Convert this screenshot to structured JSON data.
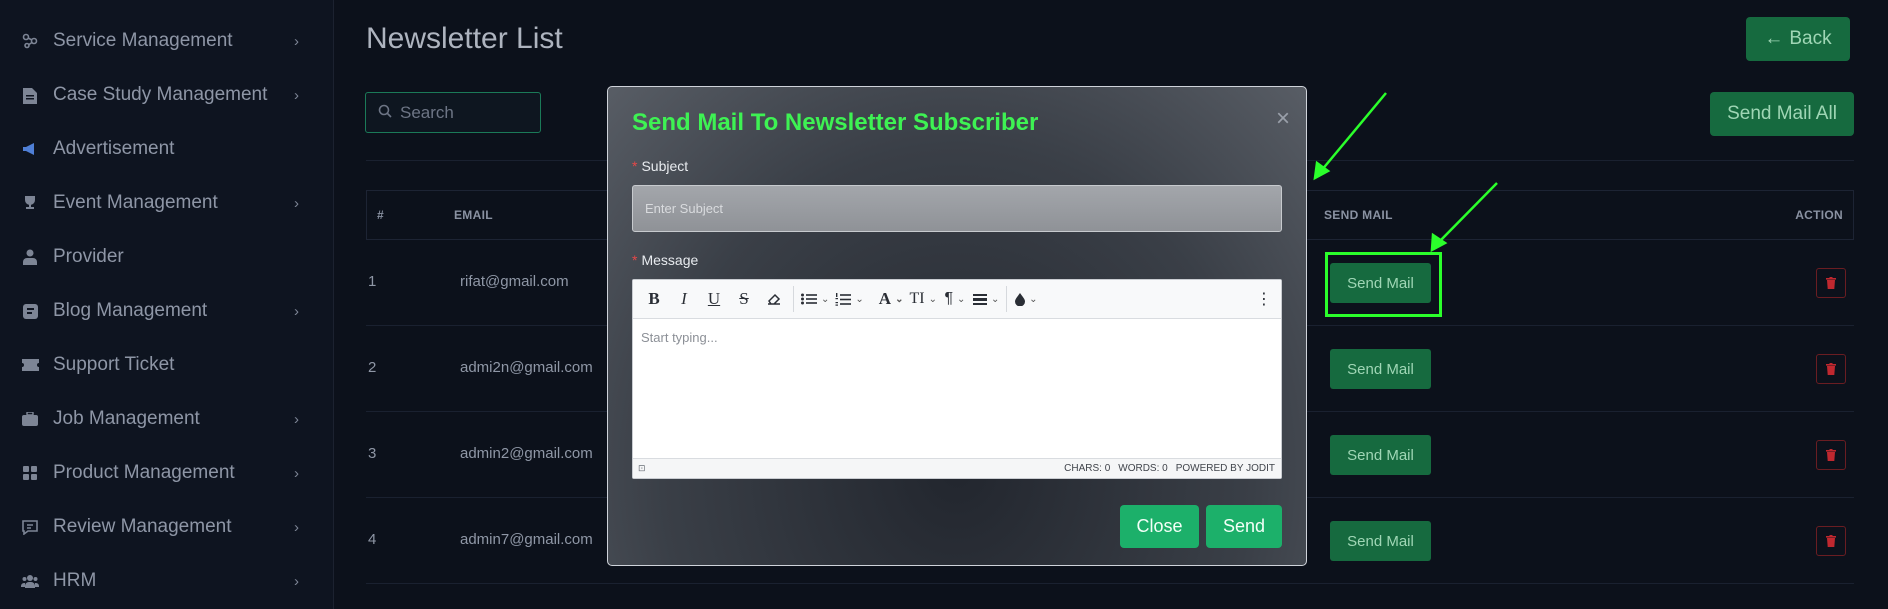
{
  "sidebar": {
    "items": [
      {
        "label": "Service Management",
        "icon": "service-icon",
        "chevron": true
      },
      {
        "label": "Case Study Management",
        "icon": "document-icon",
        "chevron": true
      },
      {
        "label": "Advertisement",
        "icon": "megaphone-icon",
        "chevron": false
      },
      {
        "label": "Event Management",
        "icon": "trophy-icon",
        "chevron": true
      },
      {
        "label": "Provider",
        "icon": "user-icon",
        "chevron": false
      },
      {
        "label": "Blog Management",
        "icon": "blog-icon",
        "chevron": true
      },
      {
        "label": "Support Ticket",
        "icon": "ticket-icon",
        "chevron": false
      },
      {
        "label": "Job Management",
        "icon": "briefcase-icon",
        "chevron": true
      },
      {
        "label": "Product Management",
        "icon": "grid-icon",
        "chevron": true
      },
      {
        "label": "Review Management",
        "icon": "comment-icon",
        "chevron": true
      },
      {
        "label": "HRM",
        "icon": "users-icon",
        "chevron": true
      }
    ]
  },
  "header": {
    "title": "Newsletter List",
    "back_label": "Back"
  },
  "toolbar": {
    "search_placeholder": "Search",
    "send_all_label": "Send Mail All"
  },
  "table": {
    "headers": {
      "num": "#",
      "email": "EMAIL",
      "send": "SEND MAIL",
      "action": "ACTION"
    },
    "rows": [
      {
        "num": "1",
        "email": "rifat@gmail.com",
        "send_label": "Send Mail"
      },
      {
        "num": "2",
        "email": "admi2n@gmail.com",
        "send_label": "Send Mail"
      },
      {
        "num": "3",
        "email": "admin2@gmail.com",
        "send_label": "Send Mail"
      },
      {
        "num": "4",
        "email": "admin7@gmail.com",
        "send_label": "Send Mail"
      }
    ]
  },
  "modal": {
    "title": "Send Mail To Newsletter Subscriber",
    "close_symbol": "×",
    "required_mark": "*",
    "subject_label": "Subject",
    "subject_placeholder": "Enter Subject",
    "message_label": "Message",
    "editor_placeholder": "Start typing...",
    "status": {
      "chars": "CHARS: 0",
      "words": "WORDS: 0",
      "powered": "POWERED BY JODIT"
    },
    "close_label": "Close",
    "send_label": "Send"
  },
  "colors": {
    "accent_green": "#166a3f",
    "modal_title": "#3ef253",
    "highlight": "#2bff2b",
    "danger": "#c0282f",
    "modal_button": "#1cb06a"
  }
}
